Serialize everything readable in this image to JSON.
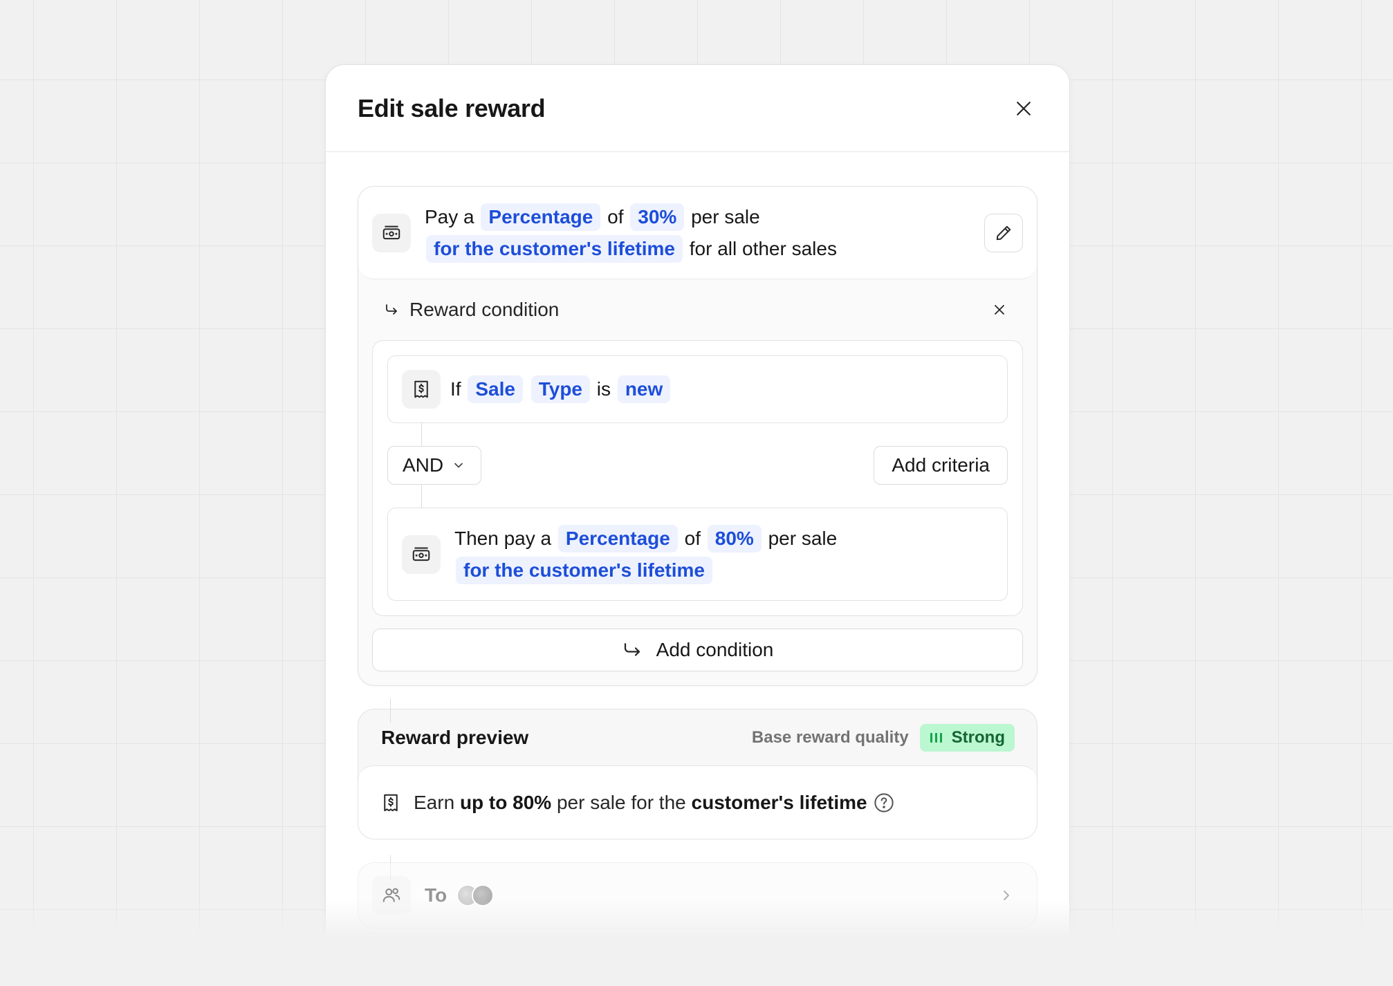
{
  "modal": {
    "title": "Edit sale reward"
  },
  "reward": {
    "prefix": "Pay a",
    "type": "Percentage",
    "of": "of",
    "amount": "30%",
    "per": "per sale",
    "duration": "for the customer's lifetime",
    "suffix": "for all other sales"
  },
  "condition": {
    "title": "Reward condition",
    "if_label": "If",
    "entity": "Sale",
    "attribute": "Type",
    "operator": "is",
    "value": "new",
    "logic": "AND",
    "add_criteria": "Add criteria",
    "then_prefix": "Then pay a",
    "then_type": "Percentage",
    "then_of": "of",
    "then_amount": "80%",
    "then_per": "per sale",
    "then_duration": "for the customer's lifetime",
    "add_condition": "Add condition"
  },
  "preview": {
    "title": "Reward preview",
    "quality_label": "Base reward quality",
    "quality_value": "Strong",
    "earn": "Earn",
    "earn_amount": "up to 80%",
    "earn_mid": "per sale for the",
    "earn_duration": "customer's lifetime"
  },
  "audience": {
    "label": "To"
  },
  "colors": {
    "chip_bg": "#eef2ff",
    "chip_text": "#1d4ed8",
    "strong_bg": "#bbf7d0",
    "strong_text": "#166534"
  },
  "icons": {
    "close": "close-icon",
    "edit": "pencil-icon",
    "money": "banknote-icon",
    "receipt": "receipt-dollar-icon",
    "arrow": "corner-down-right-icon",
    "chevron": "chevron-down-icon",
    "help": "help-circle-icon",
    "users": "users-icon"
  }
}
